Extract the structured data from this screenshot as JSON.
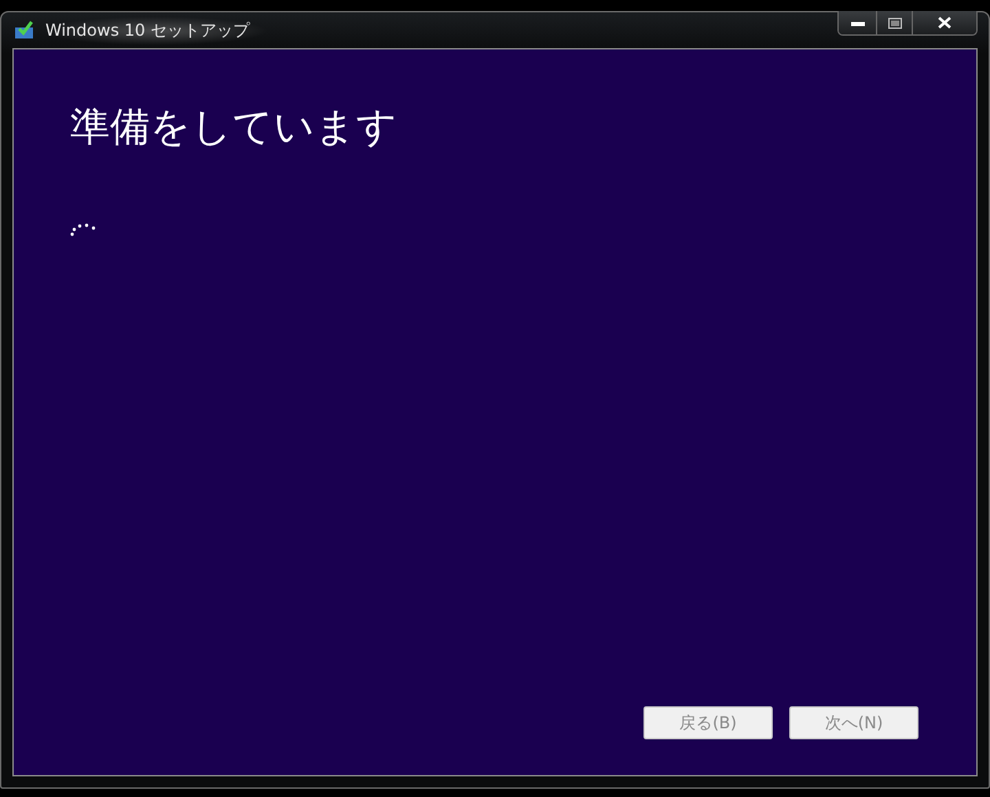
{
  "window": {
    "title": "Windows 10 セットアップ"
  },
  "heading": "準備をしています",
  "buttons": [
    {
      "label": "戻る(B)",
      "disabled": true
    },
    {
      "label": "次へ(N)",
      "disabled": true
    }
  ]
}
